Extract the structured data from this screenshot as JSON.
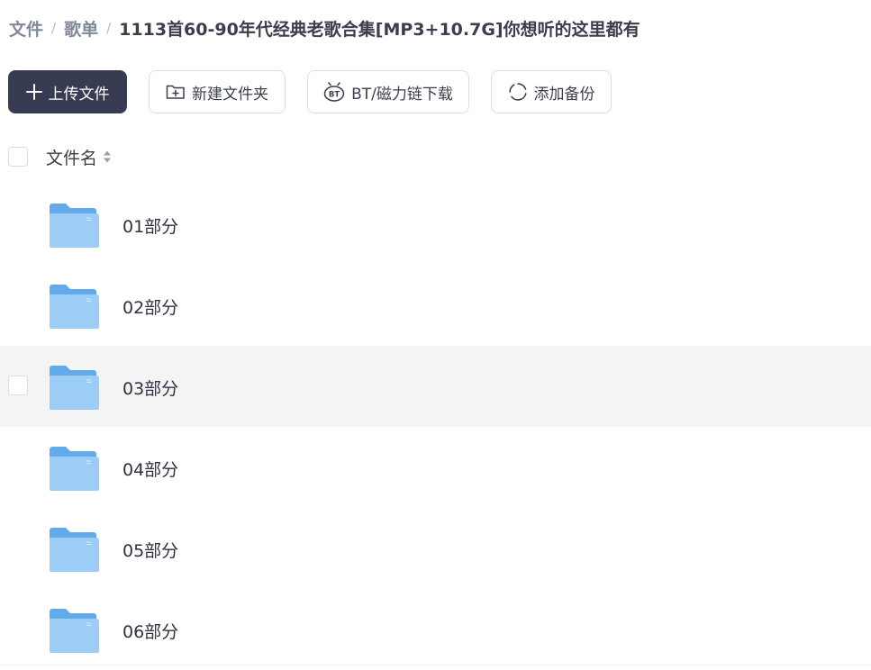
{
  "breadcrumb": {
    "items": [
      "文件",
      "歌单"
    ],
    "separator": "/",
    "current": "1113首60-90年代经典老歌合集[MP3+10.7G]你想听的这里都有"
  },
  "toolbar": {
    "upload_label": "上传文件",
    "new_folder_label": "新建文件夹",
    "bt_label": "BT/磁力链下载",
    "backup_label": "添加备份"
  },
  "list": {
    "header_label": "文件名",
    "rows": [
      {
        "name": "01部分",
        "type": "folder"
      },
      {
        "name": "02部分",
        "type": "folder"
      },
      {
        "name": "03部分",
        "type": "folder"
      },
      {
        "name": "04部分",
        "type": "folder"
      },
      {
        "name": "05部分",
        "type": "folder"
      },
      {
        "name": "06部分",
        "type": "folder"
      }
    ]
  },
  "colors": {
    "primary_button": "#383c52",
    "folder_front": "#9ccdf6",
    "folder_back": "#63aaeb",
    "hover_row": "#f4f4f5"
  }
}
